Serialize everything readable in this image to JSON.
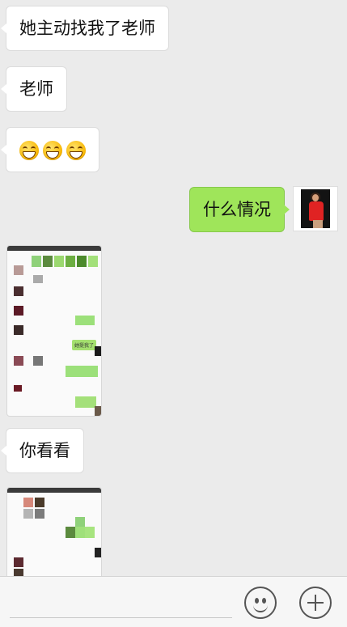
{
  "messages": {
    "m1": "她主动找我了老师",
    "m2": "老师",
    "m4": "什么情况",
    "m5": "你看看"
  },
  "embedded_screenshot": {
    "label": "她挺我了"
  },
  "icons": {
    "emoji": "grinning-face-icon",
    "voice": "smiley-icon",
    "more": "plus-icon"
  },
  "colors": {
    "background": "#ebebeb",
    "incoming_bubble": "#ffffff",
    "outgoing_bubble": "#9fe55a"
  }
}
